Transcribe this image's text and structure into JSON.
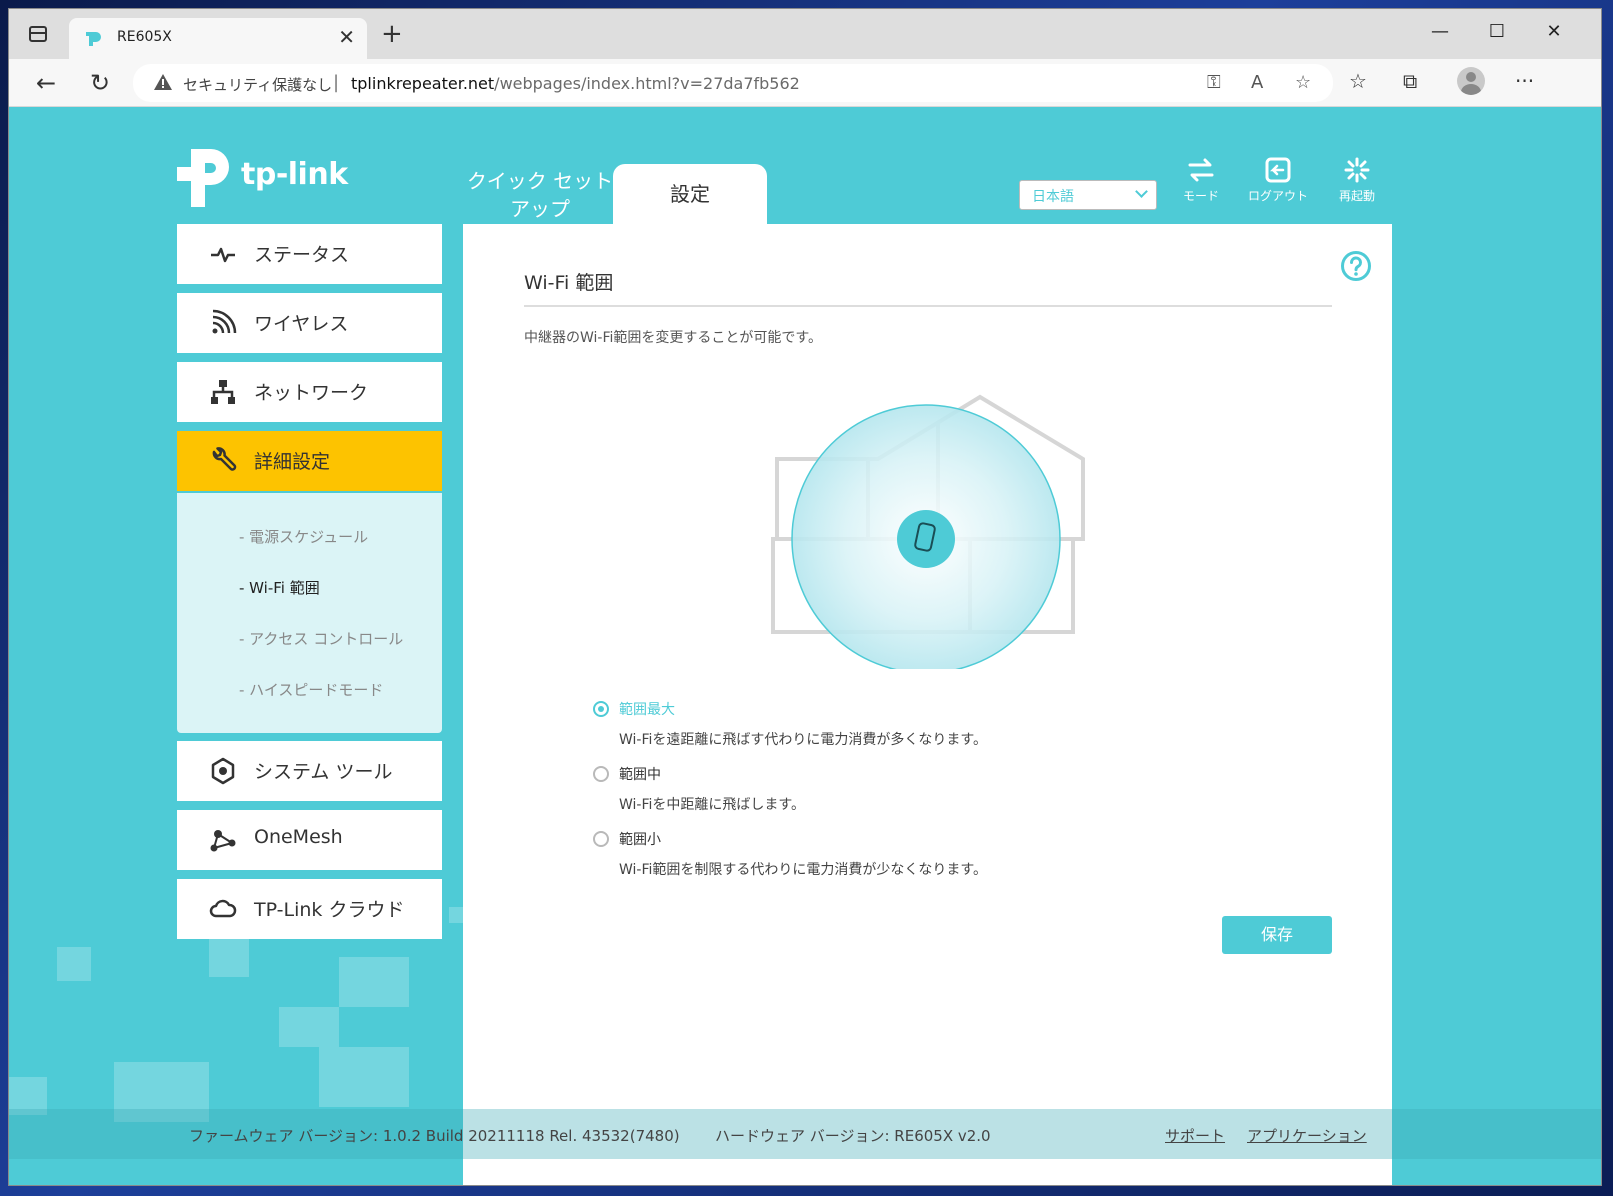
{
  "browser": {
    "tab_title": "RE605X",
    "security_text": "セキュリティ保護なし",
    "url_host": "tplinkrepeater.net",
    "url_path": "/webpages/index.html?v=27da7fb562"
  },
  "header": {
    "logo_text": "tp-link",
    "tab_quick": "クイック セット アップ",
    "tab_settings": "設定",
    "language": "日本語",
    "actions": {
      "mode": "モード",
      "logout": "ログアウト",
      "reboot": "再起動"
    }
  },
  "sidebar": {
    "items": [
      {
        "label": "ステータス"
      },
      {
        "label": "ワイヤレス"
      },
      {
        "label": "ネットワーク"
      },
      {
        "label": "詳細設定"
      },
      {
        "label": "システム ツール"
      },
      {
        "label": "OneMesh"
      },
      {
        "label": "TP-Link クラウド"
      }
    ],
    "submenu": [
      {
        "label": "- 電源スケジュール"
      },
      {
        "label": "- Wi-Fi 範囲"
      },
      {
        "label": "- アクセス コントロール"
      },
      {
        "label": "- ハイスピードモード"
      }
    ]
  },
  "content": {
    "title": "Wi-Fi 範囲",
    "description": "中継器のWi-Fi範囲を変更することが可能です。",
    "options": [
      {
        "label": "範囲最大",
        "desc": "Wi-Fiを遠距離に飛ばす代わりに電力消費が多くなります。",
        "selected": true
      },
      {
        "label": "範囲中",
        "desc": "Wi-Fiを中距離に飛ばします。",
        "selected": false
      },
      {
        "label": "範囲小",
        "desc": "Wi-Fi範囲を制限する代わりに電力消費が少なくなります。",
        "selected": false
      }
    ],
    "save_label": "保存"
  },
  "footer": {
    "firmware": "ファームウェア バージョン: 1.0.2 Build 20211118 Rel. 43532(7480)",
    "hardware": "ハードウェア バージョン: RE605X v2.0",
    "support": "サポート",
    "app": "アプリケーション"
  },
  "colors": {
    "accent": "#4ecbd6",
    "active_menu": "#fdc300"
  }
}
